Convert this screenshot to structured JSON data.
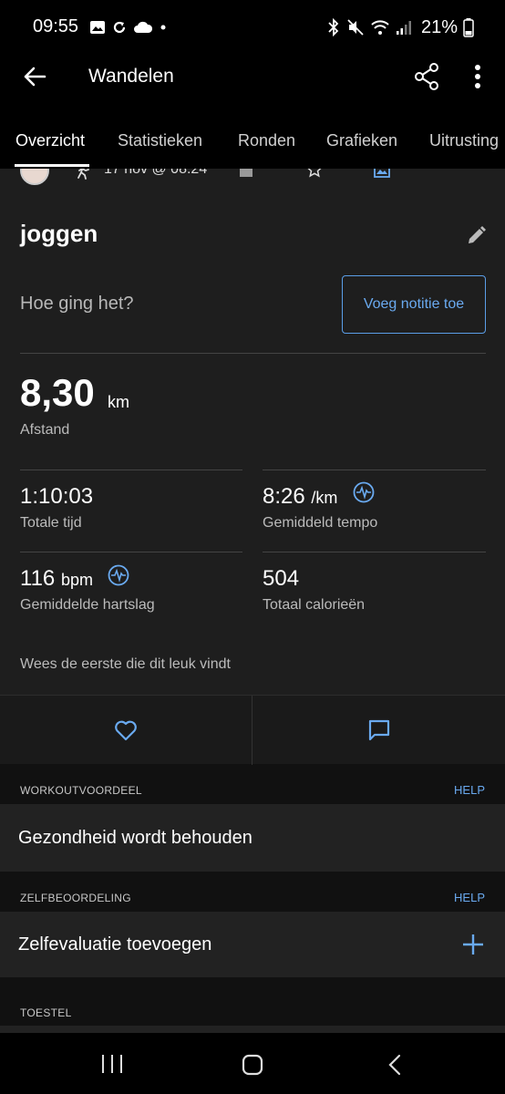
{
  "status_bar": {
    "time": "09:55",
    "battery": "21%"
  },
  "app_bar": {
    "title": "Wandelen"
  },
  "tabs": [
    {
      "label": "Overzicht",
      "active": true
    },
    {
      "label": "Statistieken",
      "active": false
    },
    {
      "label": "Ronden",
      "active": false
    },
    {
      "label": "Grafieken",
      "active": false
    },
    {
      "label": "Uitrusting",
      "active": false
    }
  ],
  "activity": {
    "date": "17 nov @ 08:24",
    "name": "joggen",
    "feeling_prompt": "Hoe ging het?",
    "add_note_label": "Voeg notitie toe"
  },
  "distance": {
    "value": "8,30",
    "unit": "km",
    "label": "Afstand"
  },
  "stats": {
    "total_time": {
      "value": "1:10:03",
      "label": "Totale tijd"
    },
    "avg_pace": {
      "value": "8:26",
      "unit": "/km",
      "label": "Gemiddeld tempo"
    },
    "avg_hr": {
      "value": "116",
      "unit": "bpm",
      "label": "Gemiddelde hartslag"
    },
    "calories": {
      "value": "504",
      "label": "Totaal calorieën"
    }
  },
  "social": {
    "likes_text": "Wees de eerste die dit leuk vindt"
  },
  "sections": {
    "workout_benefit": {
      "header": "WORKOUTVOORDEEL",
      "help": "HELP",
      "value": "Gezondheid wordt behouden"
    },
    "self_evaluation": {
      "header": "ZELFBEOORDELING",
      "help": "HELP",
      "value": "Zelfevaluatie toevoegen"
    },
    "device": {
      "header": "TOESTEL"
    }
  },
  "colors": {
    "accent": "#6aaaf0",
    "background": "#111111",
    "card": "#1e1e1e"
  }
}
